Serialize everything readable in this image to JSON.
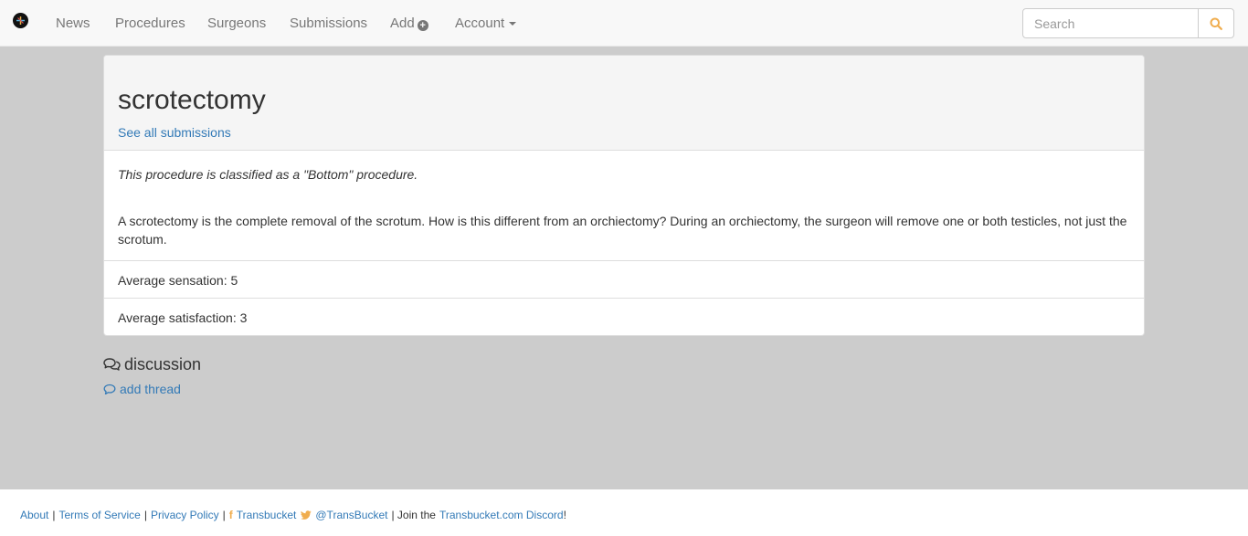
{
  "navbar": {
    "items": [
      {
        "label": "News"
      },
      {
        "label": "Procedures"
      },
      {
        "label": "Surgeons"
      },
      {
        "label": "Submissions"
      },
      {
        "label": "Add"
      },
      {
        "label": "Account"
      }
    ],
    "search": {
      "placeholder": "Search",
      "value": ""
    }
  },
  "procedure": {
    "title": "scrotectomy",
    "see_all_link": "See all submissions",
    "classification": "This procedure is classified as a \"Bottom\" procedure.",
    "description": "A scrotectomy is the complete removal of the scrotum. How is this different from an orchiectomy? During an orchiectomy, the surgeon will remove one or both testicles, not just the scrotum.",
    "average_sensation": "Average sensation: 5",
    "average_satisfaction": "Average satisfaction: 3"
  },
  "discussion": {
    "title": "discussion",
    "add_thread": "add thread"
  },
  "footer": {
    "about": "About",
    "terms": "Terms of Service",
    "privacy": "Privacy Policy",
    "facebook": "Transbucket",
    "twitter": "@TransBucket",
    "join_prefix": "| Join the",
    "discord": "Transbucket.com Discord",
    "discord_suffix": "!",
    "pipe": "|"
  },
  "colors": {
    "link": "#337ab7",
    "accent": "#f0ad4e",
    "page_bg": "#cccccc",
    "navbar_bg": "#f8f8f8"
  },
  "icons": [
    "logo-icon",
    "plus-circle-icon",
    "caret-down-icon",
    "search-icon",
    "comments-icon",
    "comment-icon",
    "facebook-icon",
    "twitter-icon"
  ]
}
